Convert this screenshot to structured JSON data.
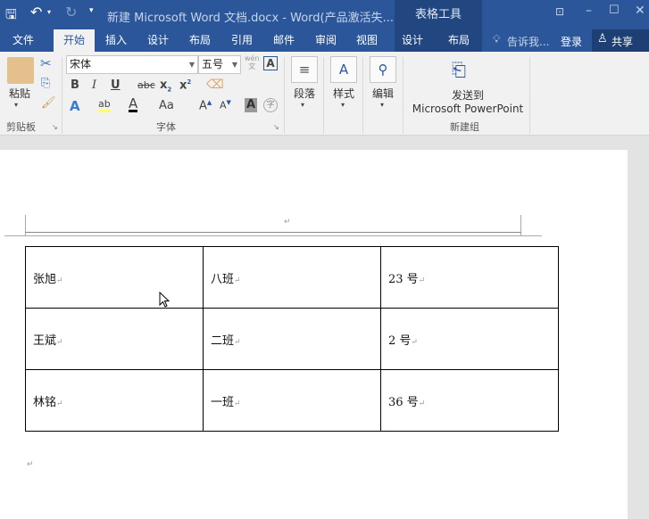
{
  "titlebar": {
    "title": "新建 Microsoft Word 文档.docx - Word(产品激活失...",
    "context_group": "表格工具"
  },
  "tabs": [
    "文件",
    "开始",
    "插入",
    "设计",
    "布局",
    "引用",
    "邮件",
    "审阅",
    "视图"
  ],
  "context_tabs": [
    "设计",
    "布局"
  ],
  "tell_me": "告诉我...",
  "signin": "登录",
  "share": "共享",
  "ribbon": {
    "clipboard": {
      "paste": "粘贴",
      "group": "剪贴板"
    },
    "font": {
      "name": "宋体",
      "size": "五号",
      "group": "字体",
      "wen": "wén",
      "wen2": "文"
    },
    "paragraph": "段落",
    "styles": "样式",
    "editing": "编辑",
    "send": {
      "line1": "发送到",
      "line2": "Microsoft PowerPoint",
      "group": "新建组"
    }
  },
  "table": [
    [
      "张旭",
      "八班",
      "23 号"
    ],
    [
      "王斌",
      "二班",
      "2 号"
    ],
    [
      "林铭",
      "一班",
      "36 号"
    ]
  ],
  "para_mark": "↵"
}
